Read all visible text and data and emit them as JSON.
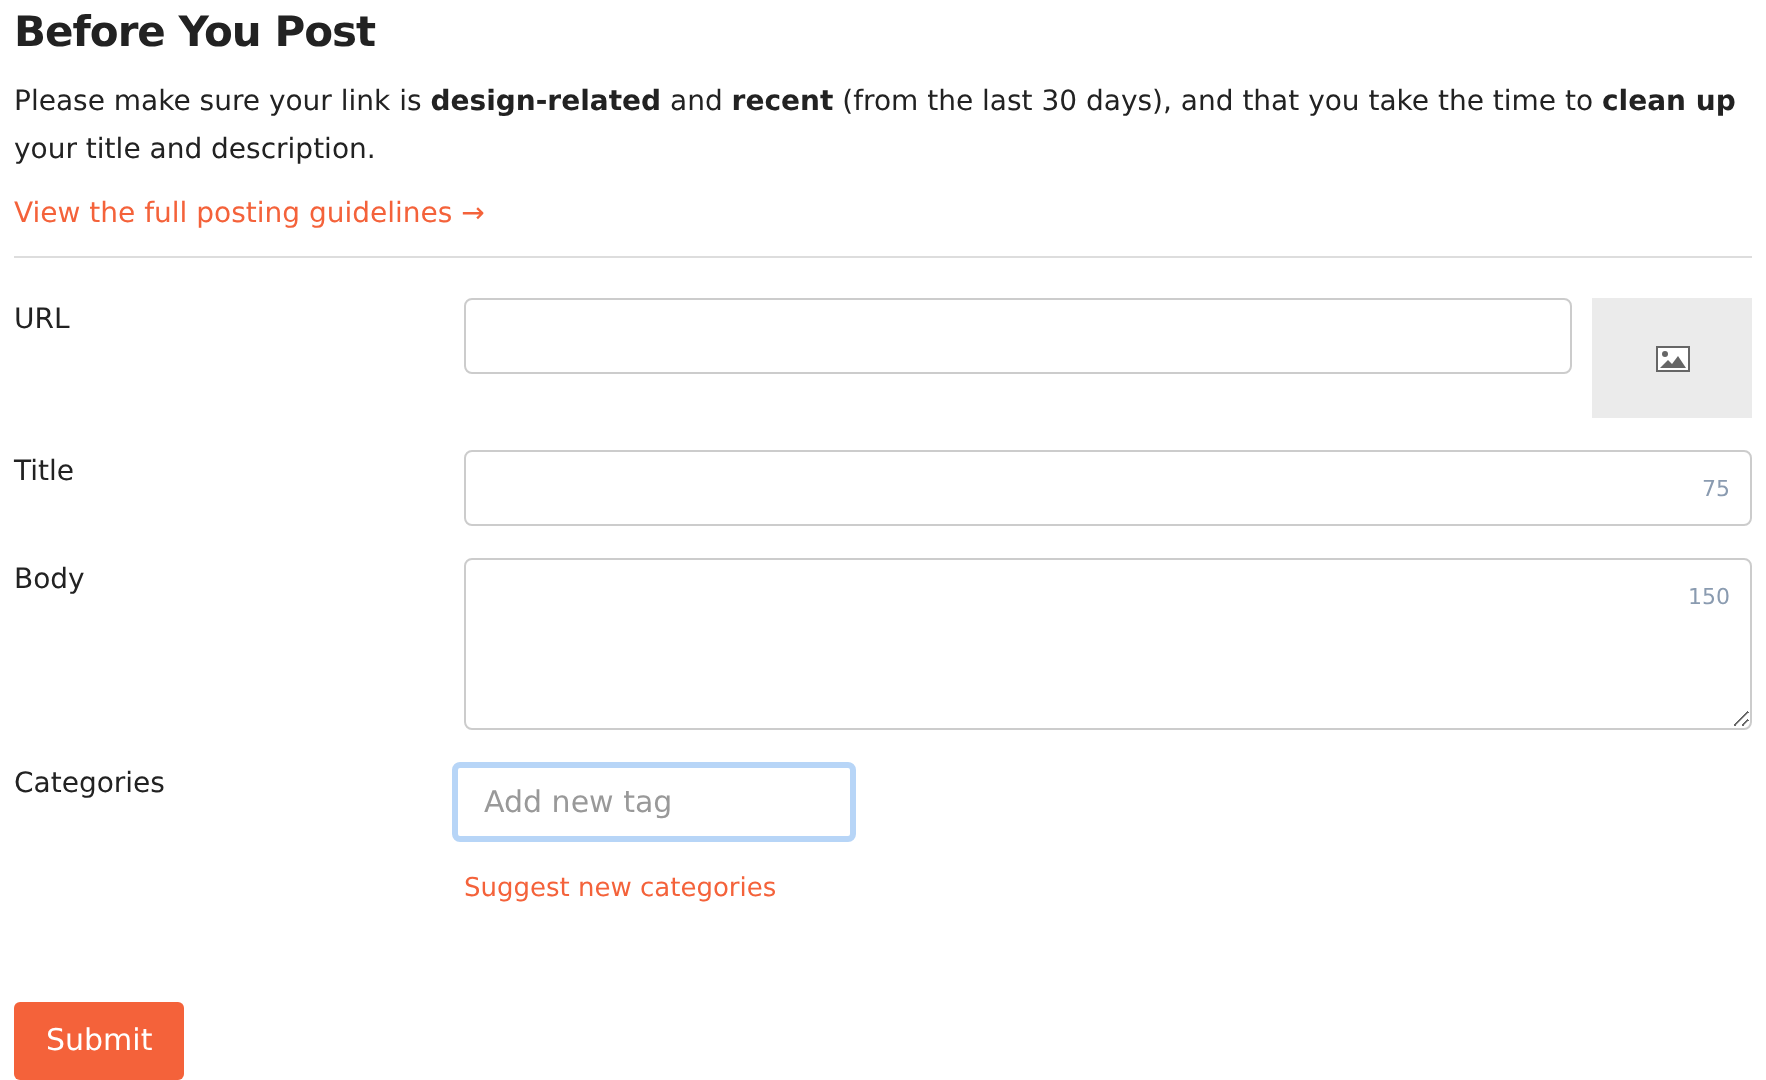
{
  "heading": "Before You Post",
  "intro": "Please make sure your link is **design-related** and **recent** (from the last 30 days), and that you take the time to **clean up** your title and description.",
  "guidelines_link": "View the full posting guidelines →",
  "fields": [
    {
      "kind": "url",
      "label": "URL"
    },
    {
      "kind": "text",
      "label": "Title",
      "counter": "75"
    },
    {
      "kind": "textarea",
      "label": "Body",
      "counter": "150"
    },
    {
      "kind": "tags",
      "label": "Categories",
      "placeholder": "Add new tag",
      "focused": true,
      "link": "Suggest new categories"
    }
  ],
  "submit": "Submit"
}
